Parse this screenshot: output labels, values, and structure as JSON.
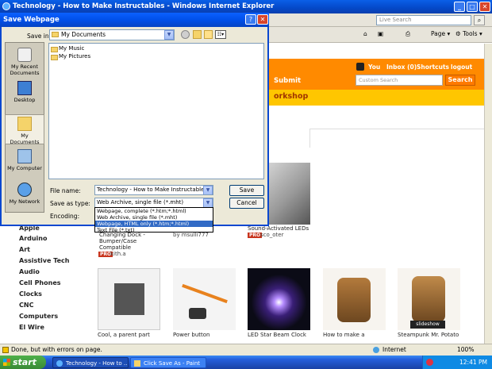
{
  "window": {
    "title": "Technology - How to Make Instructables - Windows Internet Explorer",
    "live_search_placeholder": "Live Search"
  },
  "ie_toolbar": {
    "page_label": "Page",
    "tools_label": "Tools"
  },
  "site": {
    "nav": [
      "You",
      "Inbox (0)",
      "Shortcuts",
      "logout"
    ],
    "submit_label": "Submit",
    "search_placeholder": "Custom Search",
    "search_button": "Search",
    "section_title": "orkshop",
    "categories": [
      "Apple",
      "Arduino",
      "Art",
      "Assistive Tech",
      "Audio",
      "Cell Phones",
      "Clocks",
      "CNC",
      "Computers",
      "El Wire"
    ],
    "items_row1": [
      {
        "caption_lines": [
          "Changing Dock -",
          "Bumper/Case",
          "Compatible"
        ],
        "author": "kith.a",
        "pro": "PRO"
      },
      {
        "caption_lines": [],
        "author": "by msulli777",
        "pro": ""
      },
      {
        "caption_lines": [
          "Sound-Activated LEDs"
        ],
        "author": "sco_oter",
        "pro": "PRO"
      }
    ],
    "items_row2": [
      {
        "caption": "Cool, a parent part"
      },
      {
        "caption": "Power button"
      },
      {
        "caption": "LED Star Beam Clock"
      },
      {
        "caption": "How to make a"
      },
      {
        "caption": "Steampunk Mr. Potato"
      }
    ],
    "slideshow_label": "slideshow"
  },
  "dialog": {
    "title": "Save Webpage",
    "save_in_label": "Save in:",
    "save_in_value": "My Documents",
    "places": [
      "My Recent Documents",
      "Desktop",
      "My Documents",
      "My Computer",
      "My Network"
    ],
    "files": [
      "My Music",
      "My Pictures"
    ],
    "file_name_label": "File name:",
    "file_name_value": "Technology - How to Make Instructables",
    "save_as_type_label": "Save as type:",
    "save_as_type_value": "Web Archive, single file (*.mht)",
    "encoding_label": "Encoding:",
    "type_options": [
      "Webpage, complete (*.htm;*.html)",
      "Web Archive, single file (*.mht)",
      "Webpage, HTML only (*.htm;*.html)",
      "Text File (*.txt)"
    ],
    "selected_option_index": 2,
    "save_button": "Save",
    "cancel_button": "Cancel"
  },
  "status": {
    "text": "Done, but with errors on page.",
    "zone": "Internet",
    "zoom": "100%"
  },
  "taskbar": {
    "start_label": "start",
    "tasks": [
      "Technology - How to ...",
      "Click Save As - Paint"
    ],
    "clock": "12:41 PM"
  },
  "colors": {
    "site_orange": "#ff8a00",
    "site_yellow": "#ffc600",
    "xp_blue": "#0a48d0",
    "selection": "#316ac5"
  }
}
